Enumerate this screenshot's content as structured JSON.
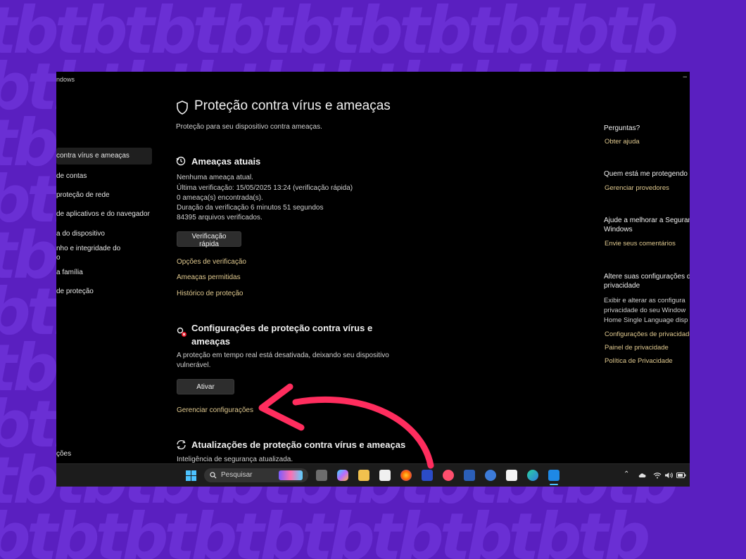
{
  "window": {
    "title": "ndows",
    "minimize": "–"
  },
  "sidebar": {
    "items": [
      {
        "label": "contra vírus e ameaças",
        "active": true
      },
      {
        "label": "de contas"
      },
      {
        "label": "proteção de rede"
      },
      {
        "label": "de aplicativos e do navegador"
      },
      {
        "label": "a do dispositivo"
      },
      {
        "label": "nho e integridade do"
      },
      {
        "label": "o"
      },
      {
        "label": "a família"
      },
      {
        "label": "de proteção"
      },
      {
        "label": "ções"
      }
    ]
  },
  "main": {
    "title": "Proteção contra vírus e ameaças",
    "subtitle": "Proteção para seu dispositivo contra ameaças.",
    "threats": {
      "heading": "Ameaças atuais",
      "lines": [
        "Nenhuma ameaça atual.",
        "Última verificação: 15/05/2025 13:24 (verificação rápida)",
        "0 ameaça(s) encontrada(s).",
        "Duração da verificação 6 minutos 51 segundos",
        "84395 arquivos verificados."
      ],
      "quick_scan_button": "Verificação rápida",
      "links": [
        "Opções de verificação",
        "Ameaças permitidas",
        "Histórico de proteção"
      ]
    },
    "settings": {
      "heading_line1": "Configurações de proteção contra vírus e",
      "heading_line2": "ameaças",
      "desc_line1": "A proteção em tempo real está desativada, deixando seu dispositivo",
      "desc_line2": "vulnerável.",
      "activate_button": "Ativar",
      "manage_link": "Gerenciar configurações"
    },
    "updates": {
      "heading": "Atualizações de proteção contra vírus e ameaças",
      "status": "Inteligência de segurança atualizada."
    }
  },
  "right_panel": {
    "questions": {
      "heading": "Perguntas?",
      "link": "Obter ajuda"
    },
    "protecting": {
      "heading": "Quem está me protegendo",
      "link": "Gerenciar provedores"
    },
    "feedback": {
      "heading_line1": "Ajude a melhorar a Seguran",
      "heading_line2": "Windows",
      "link": "Envie seus comentários"
    },
    "privacy": {
      "heading_line1": "Altere suas configurações d",
      "heading_line2": "privacidade",
      "text_lines": [
        "Exibir e alterar as configura",
        "privacidade do seu Window",
        "Home Single Language disp"
      ],
      "links": [
        "Configurações de privacidade",
        "Painel de privacidade",
        "Política de Privacidade"
      ]
    }
  },
  "taskbar": {
    "search_placeholder": "Pesquisar",
    "tray_chevron": "⌃"
  },
  "colors": {
    "accent_link": "#e0c98f",
    "background": "#5a1fc0",
    "arrow": "#ff2d5e"
  }
}
